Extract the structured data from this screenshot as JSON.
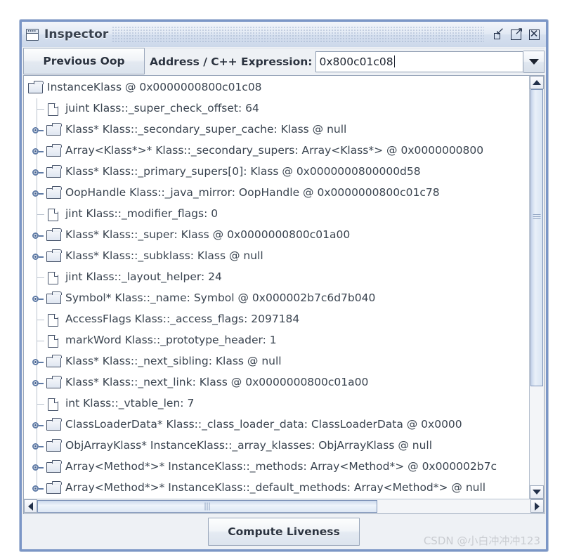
{
  "window": {
    "title": "Inspector",
    "icon": "window-icon",
    "buttons": [
      {
        "name": "minimize",
        "glyph": "↙"
      },
      {
        "name": "maximize",
        "glyph": "↗"
      },
      {
        "name": "close",
        "glyph": "✕"
      }
    ]
  },
  "toolbar": {
    "previous_oop_label": "Previous Oop",
    "address_label": "Address / C++ Expression:",
    "address_value": "0x800c01c08",
    "address_placeholder": "",
    "dropdown_icon": "chevron-down-icon"
  },
  "tree": {
    "rows": [
      {
        "text": "InstanceKlass @ 0x0000000800c01c08",
        "icon": "folder",
        "handle": false,
        "depth": 0
      },
      {
        "text": "juint Klass::_super_check_offset: 64",
        "icon": "doc",
        "handle": false,
        "depth": 1
      },
      {
        "text": "Klass* Klass::_secondary_super_cache: Klass @ null",
        "icon": "folder",
        "handle": true,
        "depth": 1
      },
      {
        "text": "Array<Klass*>* Klass::_secondary_supers: Array<Klass*> @ 0x0000000800",
        "icon": "folder",
        "handle": true,
        "depth": 1
      },
      {
        "text": "Klass* Klass::_primary_supers[0]: Klass @ 0x0000000800000d58",
        "icon": "folder",
        "handle": true,
        "depth": 1
      },
      {
        "text": "OopHandle Klass::_java_mirror: OopHandle @ 0x0000000800c01c78",
        "icon": "folder",
        "handle": true,
        "depth": 1
      },
      {
        "text": "jint Klass::_modifier_flags: 0",
        "icon": "doc",
        "handle": false,
        "depth": 1
      },
      {
        "text": "Klass* Klass::_super: Klass @ 0x0000000800c01a00",
        "icon": "folder",
        "handle": true,
        "depth": 1
      },
      {
        "text": "Klass* Klass::_subklass: Klass @ null",
        "icon": "folder",
        "handle": true,
        "depth": 1
      },
      {
        "text": "jint Klass::_layout_helper: 24",
        "icon": "doc",
        "handle": false,
        "depth": 1
      },
      {
        "text": "Symbol* Klass::_name: Symbol @ 0x000002b7c6d7b040",
        "icon": "folder",
        "handle": true,
        "depth": 1
      },
      {
        "text": "AccessFlags Klass::_access_flags: 2097184",
        "icon": "doc",
        "handle": false,
        "depth": 1
      },
      {
        "text": "markWord Klass::_prototype_header: 1",
        "icon": "doc",
        "handle": false,
        "depth": 1
      },
      {
        "text": "Klass* Klass::_next_sibling: Klass @ null",
        "icon": "folder",
        "handle": true,
        "depth": 1
      },
      {
        "text": "Klass* Klass::_next_link: Klass @ 0x0000000800c01a00",
        "icon": "folder",
        "handle": true,
        "depth": 1
      },
      {
        "text": "int Klass::_vtable_len: 7",
        "icon": "doc",
        "handle": false,
        "depth": 1
      },
      {
        "text": "ClassLoaderData* Klass::_class_loader_data: ClassLoaderData @ 0x0000",
        "icon": "folder",
        "handle": true,
        "depth": 1
      },
      {
        "text": "ObjArrayKlass* InstanceKlass::_array_klasses: ObjArrayKlass @ null",
        "icon": "folder",
        "handle": true,
        "depth": 1
      },
      {
        "text": "Array<Method*>* InstanceKlass::_methods: Array<Method*> @ 0x000002b7c",
        "icon": "folder",
        "handle": true,
        "depth": 1
      },
      {
        "text": "Array<Method*>* InstanceKlass::_default_methods: Array<Method*> @ null",
        "icon": "folder",
        "handle": true,
        "depth": 1
      }
    ]
  },
  "scrollbars": {
    "vertical": {
      "up_icon": "triangle-up-icon",
      "down_icon": "triangle-down-icon",
      "thumb_fraction": "75%"
    },
    "horizontal": {
      "left_icon": "triangle-left-icon",
      "right_icon": "triangle-right-icon",
      "thumb_fraction": "69%"
    }
  },
  "bottom": {
    "compute_liveness_label": "Compute Liveness"
  },
  "watermark": "CSDN @小白冲冲冲123"
}
